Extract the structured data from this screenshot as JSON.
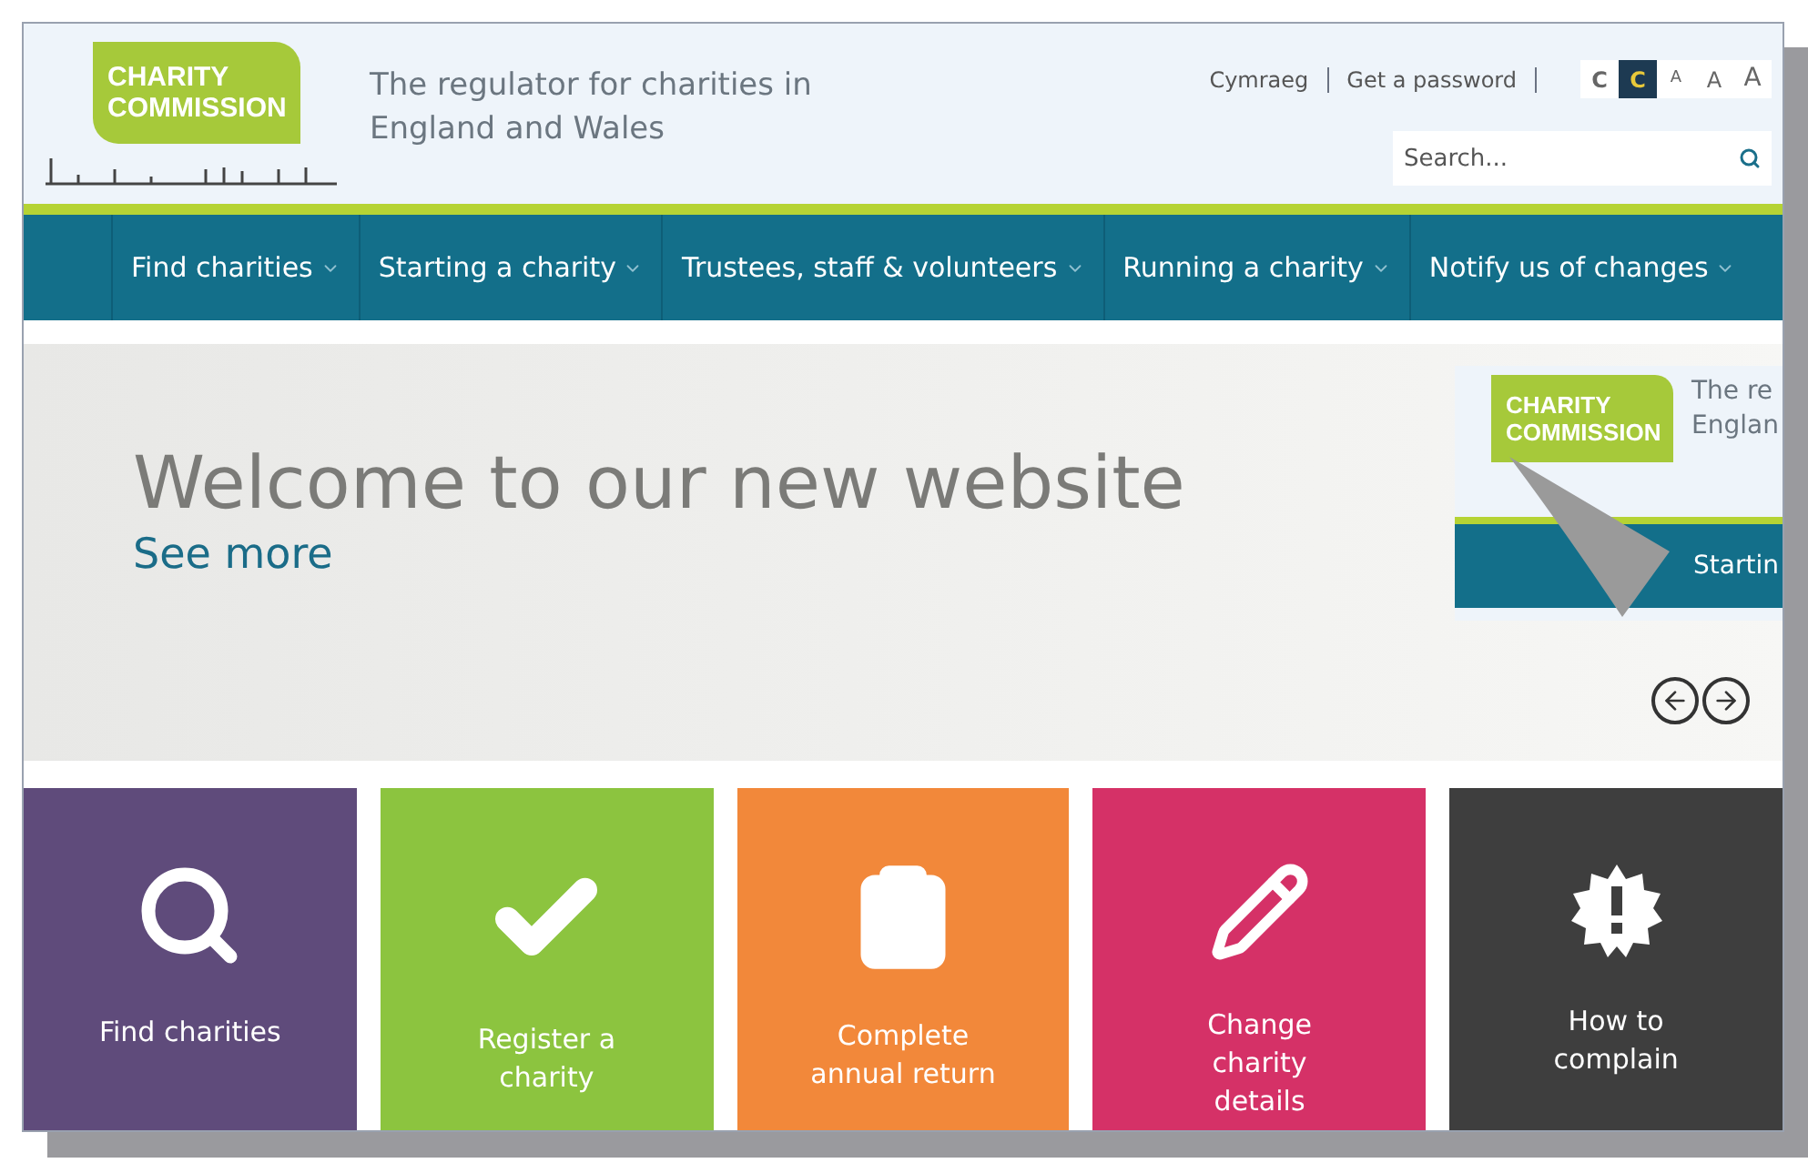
{
  "header": {
    "logo": [
      "CHARITY",
      "COMMISSION"
    ],
    "tagline": [
      "The regulator for charities in",
      "England and Wales"
    ],
    "top_links": [
      "Cymraeg",
      "Get a password"
    ],
    "contrast": [
      {
        "label": "C",
        "selected": false
      },
      {
        "label": "C",
        "selected": true
      }
    ],
    "text_size": [
      {
        "label": "A"
      },
      {
        "label": "A"
      },
      {
        "label": "A"
      }
    ],
    "search": {
      "placeholder": "Search..."
    }
  },
  "nav": [
    {
      "label": "Find charities"
    },
    {
      "label": "Starting a charity"
    },
    {
      "label": "Trustees, staff & volunteers"
    },
    {
      "label": "Running a charity"
    },
    {
      "label": "Notify us of changes"
    }
  ],
  "hero": {
    "title": "Welcome to our new website",
    "link": "See more",
    "peek": {
      "logo": [
        "CHARITY",
        "COMMISSION"
      ],
      "tagline": [
        "The re",
        "Englan"
      ],
      "nav": "Startin"
    }
  },
  "tiles": [
    {
      "label": "Find charities",
      "color": "#5f4b7b"
    },
    {
      "label": "Register a charity",
      "color": "#8cc43f"
    },
    {
      "label": "Complete annual return",
      "color": "#f2883a"
    },
    {
      "label": "Change charity details",
      "color": "#d53167"
    },
    {
      "label": "How to complain",
      "color": "#3e3e3e"
    }
  ]
}
